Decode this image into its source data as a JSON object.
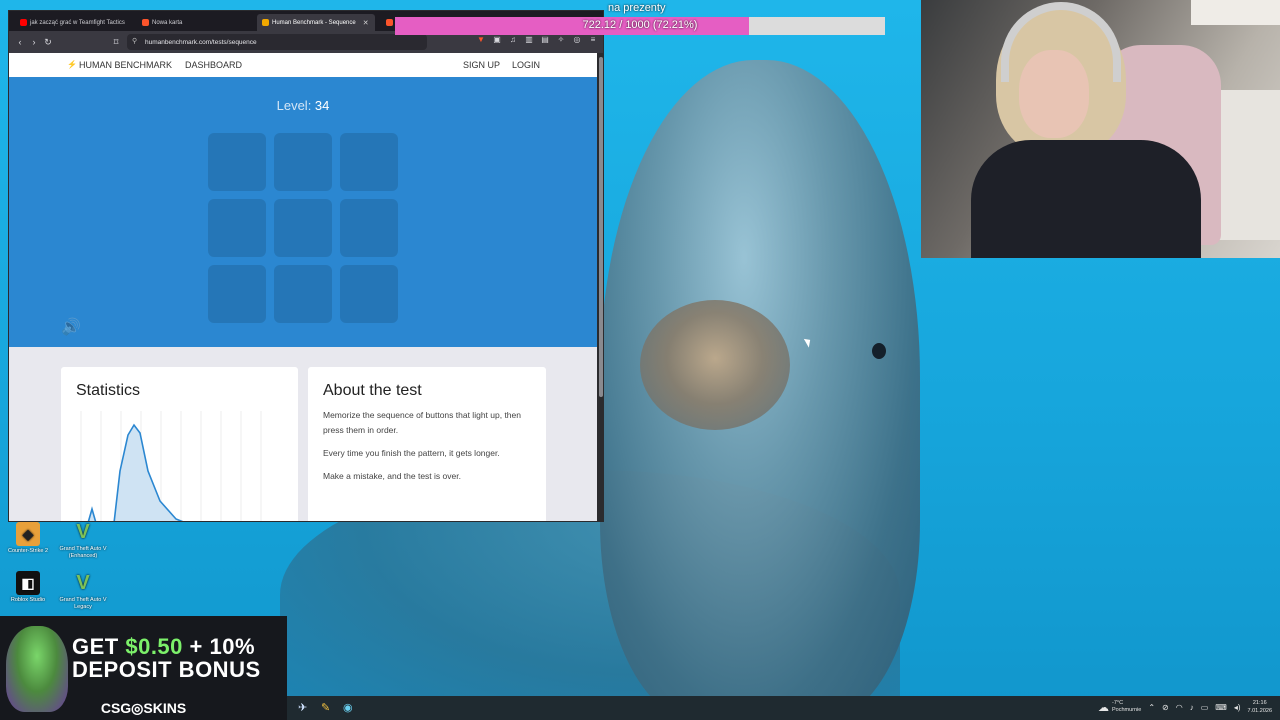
{
  "stream_goal": {
    "label": "na prezenty",
    "progress_text": "722.12 / 1000 (72.21%)",
    "progress_fraction": 0.7221,
    "fill_color": "#e55ec3"
  },
  "browser": {
    "tabs": [
      {
        "title": "jak zacząć grać w Teamfight Tactics",
        "favicon": "youtube-icon",
        "favicon_color": "#ff0000"
      },
      {
        "title": "Nowa karta",
        "favicon": "brave-icon",
        "favicon_color": "#fb542b"
      },
      {
        "title": "Human Benchmark - Sequence",
        "favicon": "human-benchmark-icon",
        "favicon_color": "#f2a900",
        "active": true
      },
      {
        "title": "",
        "favicon": "brave-icon",
        "favicon_color": "#fb542b"
      }
    ],
    "url": "humanbenchmark.com/tests/sequence"
  },
  "site": {
    "brand": "HUMAN BENCHMARK",
    "dashboard": "DASHBOARD",
    "signup": "SIGN UP",
    "login": "LOGIN",
    "accent_color": "#2b87d1"
  },
  "test": {
    "level_label": "Level: ",
    "level_value": "34"
  },
  "statistics": {
    "title": "Statistics"
  },
  "about": {
    "title": "About the test",
    "lines": [
      "Memorize the sequence of buttons that light up, then press them in order.",
      "Every time you finish the pattern, it gets longer.",
      "Make a mistake, and the test is over."
    ]
  },
  "desktop_icons": [
    {
      "label": "Counter-Strike 2",
      "icon": "cs2-icon"
    },
    {
      "label": "Grand Theft Auto V (Enhanced)",
      "icon": "gta5-icon"
    },
    {
      "label": "Roblox Studio",
      "icon": "roblox-icon"
    },
    {
      "label": "Grand Theft Auto V Legacy",
      "icon": "gta5-icon"
    }
  ],
  "ad": {
    "line1_prefix": "GET ",
    "line1_amount": "$0.50",
    "line1_suffix": " + 10%",
    "line2": "DEPOSIT BONUS",
    "brand": "CSG◎SKINS"
  },
  "taskbar": {
    "weather_temp": "-7°C",
    "weather_desc": "Pochmurnie",
    "time": "21:16",
    "date": "7.01.2026"
  }
}
